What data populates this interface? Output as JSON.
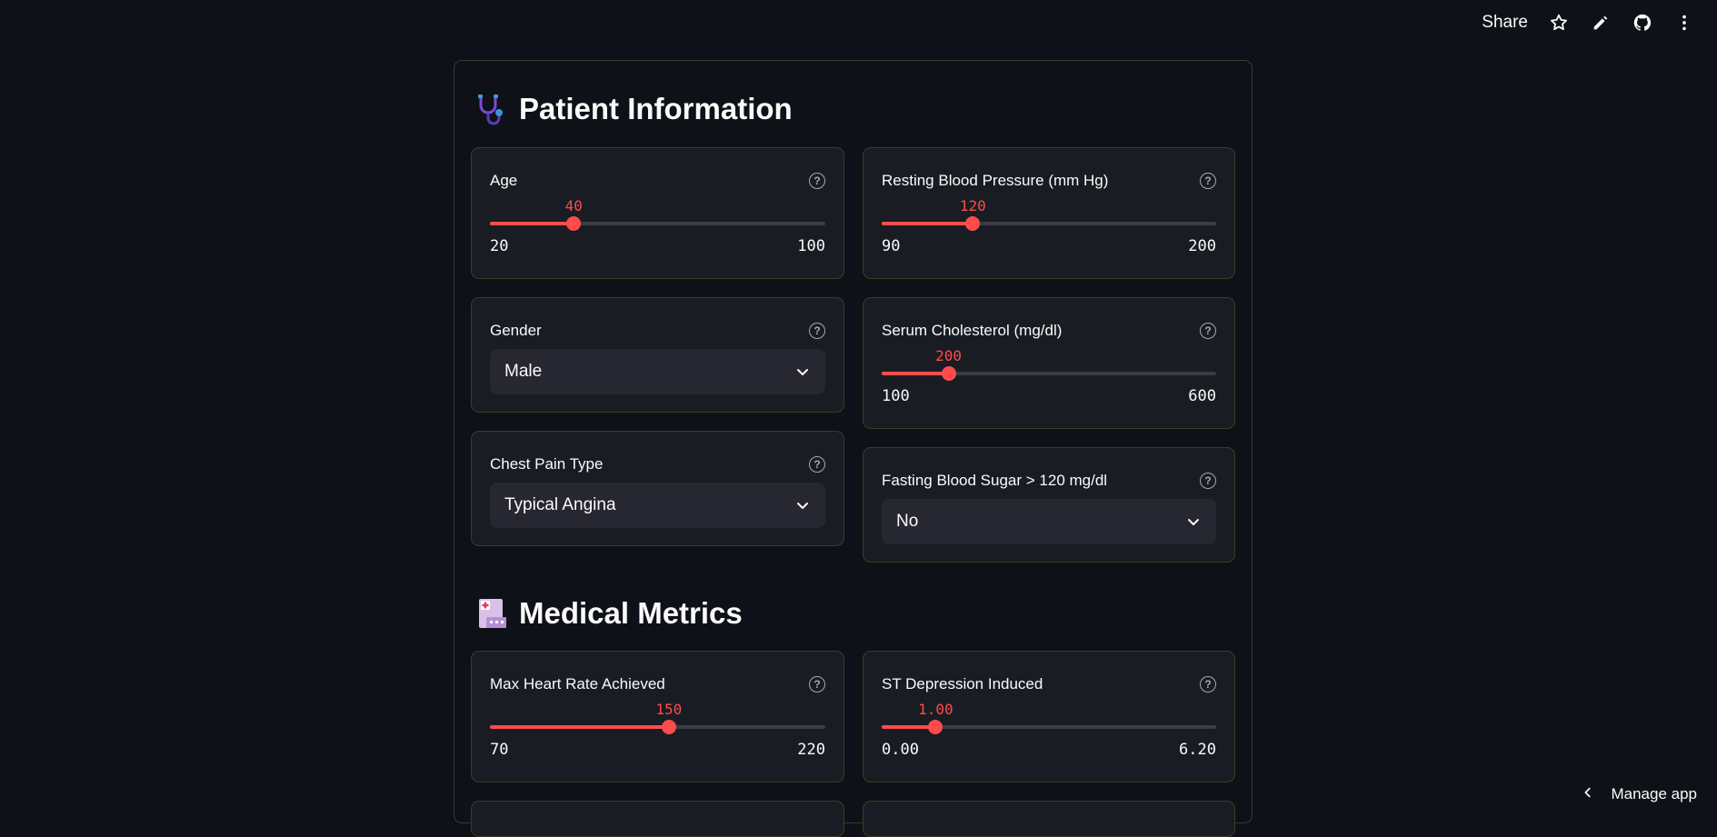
{
  "topbar": {
    "share_label": "Share"
  },
  "sections": {
    "patient": {
      "emoji": "🩺",
      "title": "Patient Information"
    },
    "medical": {
      "emoji": "🏥",
      "title": "Medical Metrics"
    }
  },
  "fields": {
    "age": {
      "label": "Age",
      "value": "40",
      "min": "20",
      "max": "100",
      "fraction": 0.25
    },
    "bp": {
      "label": "Resting Blood Pressure (mm Hg)",
      "value": "120",
      "min": "90",
      "max": "200",
      "fraction": 0.2727
    },
    "gender": {
      "label": "Gender",
      "selected": "Male"
    },
    "chol": {
      "label": "Serum Cholesterol (mg/dl)",
      "value": "200",
      "min": "100",
      "max": "600",
      "fraction": 0.2
    },
    "chest": {
      "label": "Chest Pain Type",
      "selected": "Typical Angina"
    },
    "fbs": {
      "label": "Fasting Blood Sugar > 120 mg/dl",
      "selected": "No"
    },
    "hr": {
      "label": "Max Heart Rate Achieved",
      "value": "150",
      "min": "70",
      "max": "220",
      "fraction": 0.5333
    },
    "st": {
      "label": "ST Depression Induced",
      "value": "1.00",
      "min": "0.00",
      "max": "6.20",
      "fraction": 0.1613
    }
  },
  "footer": {
    "manage_label": "Manage app"
  },
  "colors": {
    "accent": "#ff4b4b",
    "background": "#0e1117",
    "widget": "#1a1c23"
  }
}
